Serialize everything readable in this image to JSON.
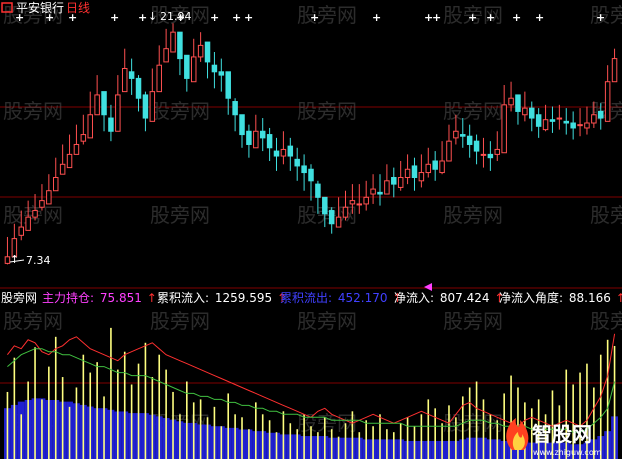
{
  "header": {
    "stock_name": "平安银行",
    "period": "日线",
    "colors": {
      "stock_name": "#ffffff",
      "period": "#ff3030",
      "icon": "#ff3030"
    }
  },
  "price_labels": {
    "high": "21.94",
    "low": "7.34"
  },
  "indicator_bar": {
    "name": "股旁网",
    "items": [
      {
        "label": "主力持仓:",
        "value": "75.851",
        "label_color": "#ff40ff",
        "value_color": "#ff40ff"
      },
      {
        "label": "累积流入:",
        "value": "1259.595",
        "label_color": "#ffffff",
        "value_color": "#ffffff"
      },
      {
        "label": "累积流出:",
        "value": "452.170",
        "label_color": "#4040ff",
        "value_color": "#4040ff"
      },
      {
        "label": "净流入:",
        "value": "807.424",
        "label_color": "#ffffff",
        "value_color": "#ffffff"
      },
      {
        "label": "净流入角度:",
        "value": "88.166",
        "label_color": "#ffffff",
        "value_color": "#ffffff"
      }
    ]
  },
  "watermark": {
    "text": "股旁网"
  },
  "logo": {
    "text": "智股网",
    "url": "www.zhiguw.com"
  },
  "colors": {
    "background": "#000000",
    "grid_dark_red": "#800000",
    "candle_up": "#ff5050",
    "candle_down": "#40e0e0",
    "signal": "#ffffff",
    "line_red": "#ff3030",
    "line_green": "#40c040",
    "bar_yellow": "#ffff80",
    "bar_blue": "#2020d0",
    "marker": "#ff40ff"
  },
  "chart_data": [
    {
      "type": "candlestick",
      "title": "平安银行 日线",
      "series": [
        {
          "name": "close",
          "values": [
            7.8,
            8.9,
            9.6,
            10.2,
            10.6,
            11.2,
            11.8,
            12.6,
            13.4,
            14.0,
            14.6,
            15.2,
            16.4,
            17.6,
            16.4,
            15.4,
            17.6,
            19.2,
            18.6,
            17.4,
            16.2,
            17.8,
            19.4,
            20.4,
            21.4,
            19.8,
            18.6,
            19.9,
            20.6,
            19.6,
            19.0,
            18.8,
            17.4,
            16.4,
            15.2,
            14.6,
            15.4,
            15.0,
            14.4,
            13.9,
            14.3,
            13.9,
            13.3,
            12.9,
            12.4,
            11.4,
            10.4,
            9.8,
            10.2,
            10.8,
            11.2,
            11.0,
            11.4,
            11.9,
            11.6,
            12.4,
            12.2,
            12.6,
            13.1,
            12.6,
            12.9,
            13.4,
            13.1,
            13.6,
            14.8,
            15.4,
            15.1,
            14.6,
            14.2,
            14.0,
            13.8,
            14.3,
            17.0,
            17.4,
            16.6,
            16.8,
            16.2,
            15.7,
            16.1,
            16.0,
            16.2,
            15.9,
            15.6,
            15.8,
            15.9,
            16.4,
            16.2,
            18.4,
            19.8
          ]
        },
        {
          "name": "high",
          "values": [
            9.0,
            9.8,
            10.6,
            11.2,
            11.6,
            12.2,
            12.8,
            13.8,
            14.6,
            15.2,
            15.8,
            16.4,
            17.8,
            18.8,
            17.4,
            17.0,
            18.8,
            20.4,
            19.8,
            18.8,
            17.8,
            19.2,
            20.6,
            21.6,
            21.94,
            21.0,
            19.8,
            21.0,
            21.4,
            20.6,
            20.2,
            19.8,
            18.6,
            17.4,
            16.4,
            15.8,
            16.4,
            16.2,
            15.6,
            15.0,
            15.4,
            15.0,
            14.4,
            14.0,
            13.4,
            12.4,
            11.4,
            10.8,
            11.4,
            11.8,
            12.2,
            12.2,
            12.4,
            12.8,
            12.8,
            13.4,
            13.2,
            13.6,
            14.0,
            13.8,
            14.0,
            14.4,
            14.2,
            14.8,
            15.8,
            16.4,
            16.2,
            15.8,
            15.2,
            15.0,
            14.8,
            15.4,
            18.2,
            18.4,
            17.6,
            17.8,
            17.2,
            16.8,
            17.0,
            16.9,
            17.0,
            16.8,
            16.6,
            16.8,
            16.9,
            17.2,
            17.1,
            19.4,
            20.4
          ]
        },
        {
          "name": "low",
          "values": [
            7.34,
            8.2,
            8.8,
            9.6,
            10.0,
            10.6,
            11.2,
            12.0,
            12.8,
            13.4,
            14.0,
            14.6,
            15.8,
            16.4,
            15.4,
            14.8,
            16.6,
            18.2,
            17.6,
            16.6,
            15.4,
            16.8,
            18.6,
            19.6,
            20.2,
            18.8,
            17.8,
            19.0,
            19.6,
            18.6,
            18.0,
            17.8,
            16.4,
            15.4,
            14.4,
            13.8,
            14.6,
            14.2,
            13.6,
            13.0,
            13.4,
            13.0,
            12.4,
            11.8,
            11.2,
            10.4,
            9.6,
            9.2,
            9.6,
            10.0,
            10.4,
            10.4,
            10.6,
            11.0,
            10.9,
            11.6,
            11.4,
            11.8,
            12.2,
            11.8,
            12.0,
            12.6,
            12.4,
            12.8,
            14.0,
            14.6,
            14.4,
            13.8,
            13.4,
            13.2,
            13.0,
            13.6,
            15.4,
            16.6,
            15.8,
            16.0,
            15.4,
            15.0,
            15.4,
            15.3,
            15.5,
            15.2,
            14.9,
            15.1,
            15.2,
            15.6,
            15.5,
            16.4,
            18.6
          ]
        }
      ],
      "annotations": {
        "high": 21.94,
        "low": 7.34
      }
    },
    {
      "type": "bar",
      "title": "股旁网 主力持仓",
      "series": [
        {
          "name": "主力持仓",
          "values": [
            45,
            68,
            30,
            52,
            75,
            40,
            62,
            82,
            55,
            35,
            48,
            70,
            58,
            65,
            42,
            88,
            60,
            72,
            50,
            64,
            78,
            55,
            70,
            60,
            45,
            30,
            52,
            38,
            40,
            28,
            35,
            22,
            44,
            30,
            28,
            20,
            38,
            30,
            26,
            18,
            32,
            24,
            20,
            30,
            22,
            18,
            28,
            20,
            15,
            24,
            32,
            18,
            26,
            22,
            30,
            20,
            18,
            24,
            28,
            22,
            30,
            40,
            34,
            24,
            36,
            28,
            42,
            48,
            52,
            40,
            30,
            26,
            44,
            56,
            48,
            38,
            34,
            40,
            30,
            46,
            36,
            60,
            50,
            58,
            64,
            48,
            70,
            80,
            75.851
          ]
        },
        {
          "name": "累积流入",
          "values": [
            70,
            76,
            74,
            80,
            78,
            72,
            70,
            74,
            76,
            80,
            82,
            78,
            74,
            72,
            70,
            68,
            66,
            70,
            72,
            74,
            76,
            78,
            74,
            70,
            68,
            66,
            64,
            62,
            60,
            58,
            56,
            54,
            52,
            50,
            48,
            46,
            44,
            42,
            40,
            38,
            36,
            34,
            32,
            30,
            28,
            32,
            34,
            30,
            28,
            26,
            24,
            26,
            28,
            30,
            28,
            26,
            24,
            26,
            28,
            30,
            32,
            30,
            28,
            26,
            24,
            30,
            36,
            38,
            34,
            32,
            30,
            28,
            26,
            24,
            22,
            26,
            28,
            26,
            24,
            22,
            24,
            26,
            24,
            22,
            26,
            34,
            42,
            56,
            84
          ]
        },
        {
          "name": "累积流出",
          "values": [
            62,
            66,
            70,
            72,
            74,
            74,
            72,
            72,
            70,
            70,
            68,
            66,
            64,
            62,
            62,
            60,
            58,
            58,
            56,
            56,
            56,
            54,
            52,
            50,
            48,
            46,
            44,
            44,
            42,
            42,
            40,
            40,
            38,
            38,
            36,
            36,
            34,
            34,
            32,
            32,
            30,
            30,
            30,
            28,
            28,
            28,
            28,
            26,
            26,
            26,
            26,
            26,
            24,
            24,
            24,
            24,
            24,
            24,
            22,
            22,
            22,
            22,
            22,
            22,
            22,
            22,
            24,
            26,
            26,
            26,
            24,
            24,
            22,
            22,
            22,
            22,
            20,
            20,
            20,
            20,
            20,
            20,
            18,
            18,
            20,
            24,
            28,
            34,
            52
          ]
        }
      ]
    }
  ]
}
